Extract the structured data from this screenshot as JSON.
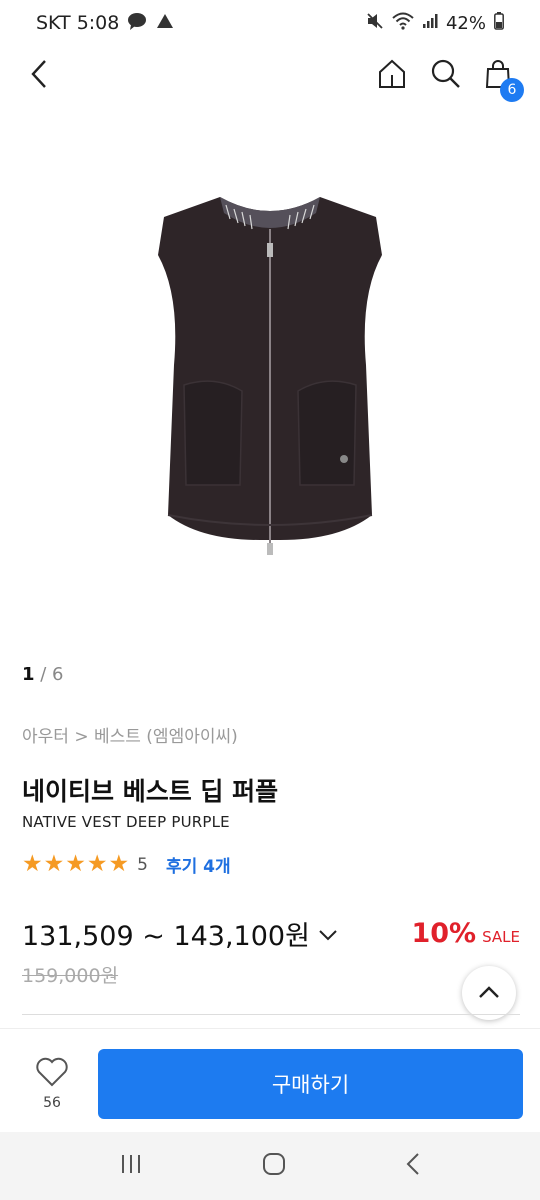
{
  "status": {
    "carrier_time": "SKT 5:08",
    "battery": "42%"
  },
  "nav": {
    "cart_count": "6"
  },
  "gallery": {
    "current": "1",
    "separator": " / ",
    "total": "6"
  },
  "product": {
    "breadcrumb": "아우터 > 베스트 (엠엠아이씨)",
    "title": "네이티브 베스트 딥 퍼플",
    "subtitle": "NATIVE VEST DEEP PURPLE",
    "rating": "5",
    "review_link": "후기 4개",
    "price": "131,509 ~ 143,100원",
    "discount": "10%",
    "sale_label": "SALE",
    "original_price": "159,000원",
    "colors": {
      "accent": "#1d7bf0",
      "sale": "#e0212b",
      "star": "#f59a23"
    }
  },
  "bottom": {
    "like_count": "56",
    "buy_label": "구매하기"
  }
}
